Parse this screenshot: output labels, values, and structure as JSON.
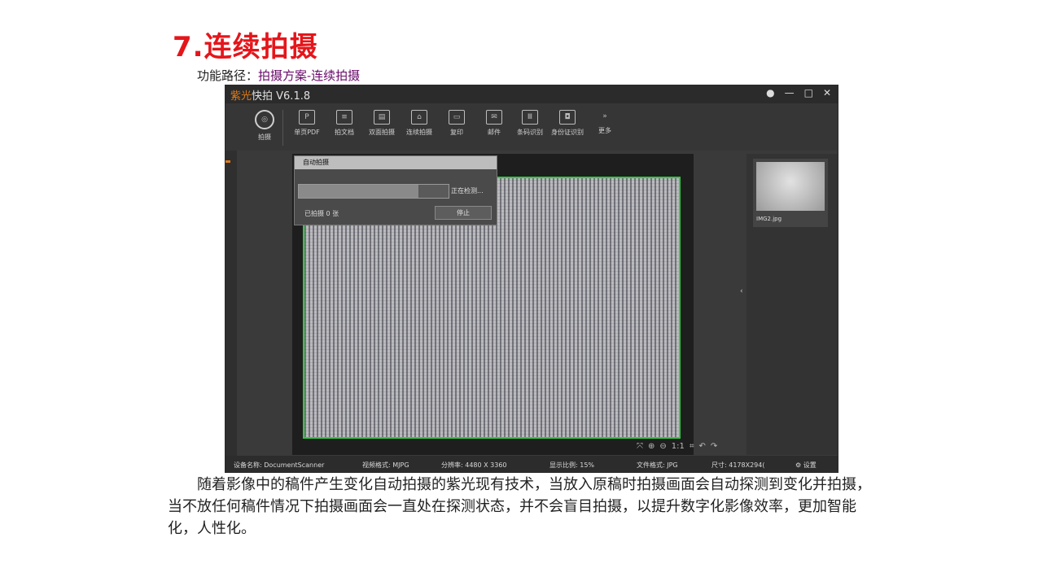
{
  "slide": {
    "title": "7.连续拍摄",
    "path_label": "功能路径：",
    "path_value": "拍摄方案-连续拍摄",
    "description": "随着影像中的稿件产生变化自动拍摄的紫光现有技术，当放入原稿时拍摄画面会自动探测到变化并拍摄，当不放任何稿件情况下拍摄画面会一直处在探测状态，并不会盲目拍摄，以提升数字化影像效率，更加智能化，人性化。"
  },
  "window": {
    "brand": "紫光",
    "app_name": "快拍 V6.1.8",
    "controls": [
      "●",
      "—",
      "□",
      "✕"
    ]
  },
  "toolbar": {
    "items": [
      {
        "label": "拍摄",
        "icon": "camera-icon",
        "glyph": "◎"
      },
      {
        "label": "单页PDF",
        "icon": "pdf-icon",
        "glyph": "P"
      },
      {
        "label": "拍文档",
        "icon": "document-icon",
        "glyph": "≡"
      },
      {
        "label": "双面拍摄",
        "icon": "duplex-icon",
        "glyph": "▤"
      },
      {
        "label": "连续拍摄",
        "icon": "continuous-icon",
        "glyph": "⌂"
      },
      {
        "label": "复印",
        "icon": "copy-icon",
        "glyph": "▭"
      },
      {
        "label": "邮件",
        "icon": "mail-icon",
        "glyph": "✉"
      },
      {
        "label": "条码识别",
        "icon": "barcode-icon",
        "glyph": "Ⅲ"
      },
      {
        "label": "身份证识别",
        "icon": "idcard-icon",
        "glyph": "◘"
      },
      {
        "label": "更多",
        "icon": "more-icon",
        "glyph": "»"
      }
    ]
  },
  "dialog": {
    "title": "自动拍摄",
    "status": "正在检测...",
    "progress": 0.8,
    "shot_count": "已拍摄   0   张",
    "stop_label": "停止"
  },
  "viewer": {
    "tools": [
      "⤧",
      "⊕",
      "⊖",
      "1:1",
      "⌗",
      "↶",
      "↷"
    ]
  },
  "thumbnail": {
    "name": "IMG2.jpg"
  },
  "statusbar": {
    "device": "设备名称:   DocumentScanner",
    "video": "视频格式:   MJPG",
    "resolution": "分辨率:   4480 X 3360",
    "ratio": "显示比例:   15%",
    "filetype": "文件格式:   JPG",
    "size": "尺寸:   4178X294(",
    "settings": "设置"
  }
}
